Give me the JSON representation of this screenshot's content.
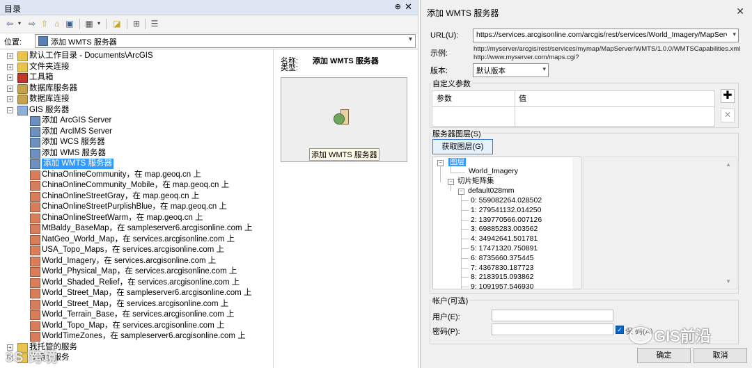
{
  "catalog": {
    "title": "目录",
    "pin": "⊕",
    "close": "✕",
    "location_label": "位置:",
    "location_value": "添加 WMTS 服务器",
    "tree": [
      {
        "label": "默认工作目录 - Documents\\ArcGIS",
        "icon": "folder-home-icon",
        "expander": "+"
      },
      {
        "label": "文件夹连接",
        "icon": "folder-connection-icon",
        "expander": "+"
      },
      {
        "label": "工具箱",
        "icon": "toolbox-icon",
        "expander": "+"
      },
      {
        "label": "数据库服务器",
        "icon": "database-server-icon",
        "expander": "+"
      },
      {
        "label": "数据库连接",
        "icon": "database-connection-icon",
        "expander": "+"
      },
      {
        "label": "GIS 服务器",
        "icon": "gis-server-icon",
        "expander": "−"
      }
    ],
    "gis_children": [
      {
        "label": "添加 ArcGIS Server",
        "icon": "add-server-icon"
      },
      {
        "label": "添加 ArcIMS Server",
        "icon": "add-server-icon"
      },
      {
        "label": "添加 WCS 服务器",
        "icon": "add-server-icon"
      },
      {
        "label": "添加 WMS 服务器",
        "icon": "add-server-icon"
      },
      {
        "label": "添加 WMTS 服务器",
        "icon": "add-server-icon",
        "selected": true
      },
      {
        "label": "ChinaOnlineCommunity，在 map.geoq.cn 上",
        "icon": "map-service-icon"
      },
      {
        "label": "ChinaOnlineCommunity_Mobile，在 map.geoq.cn 上",
        "icon": "map-service-icon"
      },
      {
        "label": "ChinaOnlineStreetGray，在 map.geoq.cn 上",
        "icon": "map-service-icon"
      },
      {
        "label": "ChinaOnlineStreetPurplishBlue，在 map.geoq.cn 上",
        "icon": "map-service-icon"
      },
      {
        "label": "ChinaOnlineStreetWarm，在 map.geoq.cn 上",
        "icon": "map-service-icon"
      },
      {
        "label": "MtBaldy_BaseMap，在 sampleserver6.arcgisonline.com 上",
        "icon": "map-service-icon"
      },
      {
        "label": "NatGeo_World_Map，在 services.arcgisonline.com 上",
        "icon": "map-service-icon"
      },
      {
        "label": "USA_Topo_Maps，在 services.arcgisonline.com 上",
        "icon": "map-service-icon"
      },
      {
        "label": "World_Imagery，在 services.arcgisonline.com 上",
        "icon": "map-service-icon"
      },
      {
        "label": "World_Physical_Map，在 services.arcgisonline.com 上",
        "icon": "map-service-icon"
      },
      {
        "label": "World_Shaded_Relief，在 services.arcgisonline.com 上",
        "icon": "map-service-icon"
      },
      {
        "label": "World_Street_Map，在 sampleserver6.arcgisonline.com 上",
        "icon": "map-service-icon"
      },
      {
        "label": "World_Street_Map，在 services.arcgisonline.com 上",
        "icon": "map-service-icon"
      },
      {
        "label": "World_Terrain_Base，在 services.arcgisonline.com 上",
        "icon": "map-service-icon"
      },
      {
        "label": "World_Topo_Map，在 services.arcgisonline.com 上",
        "icon": "map-service-icon"
      },
      {
        "label": "WorldTimeZones，在 sampleserver6.arcgisonline.com 上",
        "icon": "map-service-icon"
      }
    ],
    "trailing": [
      {
        "label": "我托管的服务",
        "icon": "hosted-services-icon",
        "expander": "+"
      },
      {
        "label": "即用型服务",
        "icon": "ready-services-icon",
        "expander": "+"
      }
    ],
    "detail": {
      "name_key": "名称:",
      "type_key": "类型:",
      "name_value": "添加 WMTS 服务器",
      "thumbnail_caption": "添加 WMTS 服务器"
    },
    "watermark": "3S 跨境"
  },
  "dialog": {
    "title": "添加 WMTS 服务器",
    "close": "✕",
    "url_label": "URL(U):",
    "url_value": "https://services.arcgisonline.com/arcgis/rest/services/World_Imagery/MapServer/WMT",
    "example_label": "示例:",
    "example_line1": "http://myserver/arcgis/rest/services/mymap/MapServer/WMTS/1.0.0/WMTSCapabilities.xml",
    "example_line2": "http://www.myserver.com/maps.cgi?",
    "version_label": "版本:",
    "version_value": "默认版本",
    "custom_params_title": "自定义参数",
    "param_col": "参数",
    "value_col": "值",
    "add_btn": "✚",
    "remove_btn": "✕",
    "layers_title": "服务器图层(S)",
    "get_layers_btn": "获取图层(G)",
    "layer_tree": {
      "layers": "图层",
      "world_imagery": "World_Imagery",
      "tile_matrix_sets": "切片矩阵集",
      "default_set": "default028mm",
      "levels": [
        "0: 559082264.028502",
        "1: 279541132.014250",
        "2: 139770566.007126",
        "3: 69885283.003562",
        "4: 34942641.501781",
        "5: 17471320.750891",
        "6: 8735660.375445",
        "7: 4367830.187723",
        "8: 2183915.093862",
        "9: 1091957.546930"
      ]
    },
    "account_title": "帐户(可选)",
    "user_label": "用户(E):",
    "password_label": "密码(P):",
    "save_password_partial": "保   码(A)",
    "ok_btn": "确定",
    "cancel_btn": "取消",
    "watermark": "GIS前沿"
  }
}
